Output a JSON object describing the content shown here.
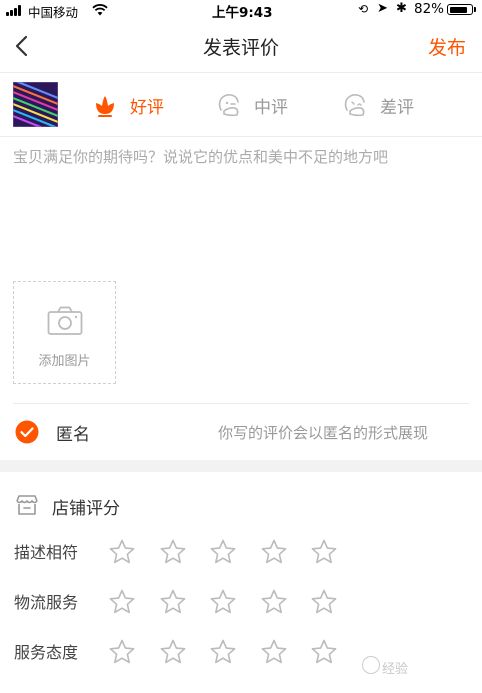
{
  "status_bar": {
    "carrier": "中国移动",
    "time": "上午9:43",
    "battery_percent": "82%",
    "battery_level": 0.82
  },
  "nav": {
    "title": "发表评价",
    "publish_label": "发布",
    "back_icon": "chevron-left-icon"
  },
  "rating": {
    "options": [
      {
        "label": "好评",
        "icon": "good-flower-icon",
        "selected": true
      },
      {
        "label": "中评",
        "icon": "neutral-face-icon",
        "selected": false
      },
      {
        "label": "差评",
        "icon": "bad-face-icon",
        "selected": false
      }
    ]
  },
  "review": {
    "placeholder": "宝贝满足你的期待吗？说说它的优点和美中不足的地方吧",
    "value": ""
  },
  "photo": {
    "add_label": "添加图片",
    "icon": "camera-icon"
  },
  "anonymous": {
    "label": "匿名",
    "checked": true,
    "hint": "你写的评价会以匿名的形式展现"
  },
  "shop_rating": {
    "title": "店铺评分",
    "icon": "store-icon",
    "max_stars": 5,
    "rows": [
      {
        "label": "描述相符",
        "stars": 0
      },
      {
        "label": "物流服务",
        "stars": 0
      },
      {
        "label": "服务态度",
        "stars": 0
      }
    ]
  },
  "colors": {
    "accent": "#ff5500",
    "muted_text": "#999999",
    "placeholder": "#aaaaaa",
    "separator": "#f2f2f2"
  }
}
